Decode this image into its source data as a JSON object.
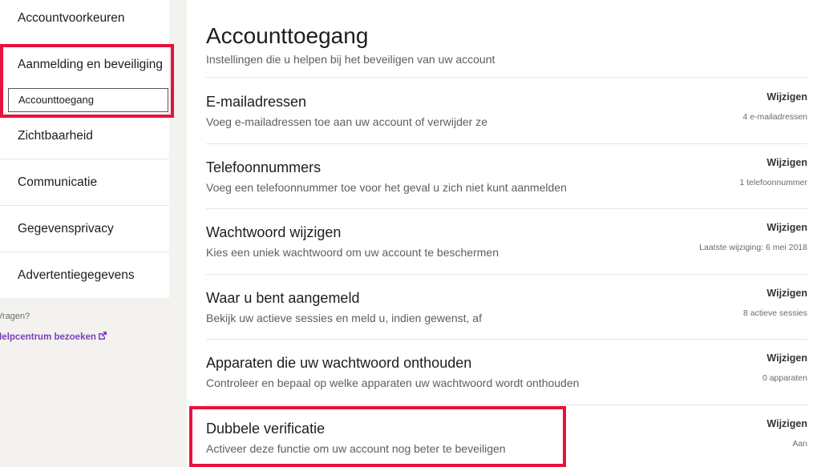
{
  "sidebar": {
    "items": [
      {
        "label": "Accountvoorkeuren"
      },
      {
        "label": "Aanmelding en beveiliging"
      },
      {
        "label": "Zichtbaarheid"
      },
      {
        "label": "Communicatie"
      },
      {
        "label": "Gegevensprivacy"
      },
      {
        "label": "Advertentiegegevens"
      }
    ],
    "active_sub": "Accounttoegang",
    "questions": "Vragen?",
    "help_link": "Helpcentrum bezoeken",
    "link_color": "#7b3fbf"
  },
  "main": {
    "title": "Accounttoegang",
    "subtitle": "Instellingen die u helpen bij het beveiligen van uw account",
    "rows": [
      {
        "title": "E-mailadressen",
        "desc": "Voeg e-mailadressen toe aan uw account of verwijder ze",
        "action": "Wijzigen",
        "status": "4 e-mailadressen"
      },
      {
        "title": "Telefoonnummers",
        "desc": "Voeg een telefoonnummer toe voor het geval u zich niet kunt aanmelden",
        "action": "Wijzigen",
        "status": "1 telefoonnummer"
      },
      {
        "title": "Wachtwoord wijzigen",
        "desc": "Kies een uniek wachtwoord om uw account te beschermen",
        "action": "Wijzigen",
        "status": "Laatste wijziging: 6 mei 2018"
      },
      {
        "title": "Waar u bent aangemeld",
        "desc": "Bekijk uw actieve sessies en meld u, indien gewenst, af",
        "action": "Wijzigen",
        "status": "8 actieve sessies"
      },
      {
        "title": "Apparaten die uw wachtwoord onthouden",
        "desc": "Controleer en bepaal op welke apparaten uw wachtwoord wordt onthouden",
        "action": "Wijzigen",
        "status": "0 apparaten"
      },
      {
        "title": "Dubbele verificatie",
        "desc": "Activeer deze functie om uw account nog beter te beveiligen",
        "action": "Wijzigen",
        "status": "Aan"
      }
    ]
  },
  "annotation_color": "#e8123a"
}
